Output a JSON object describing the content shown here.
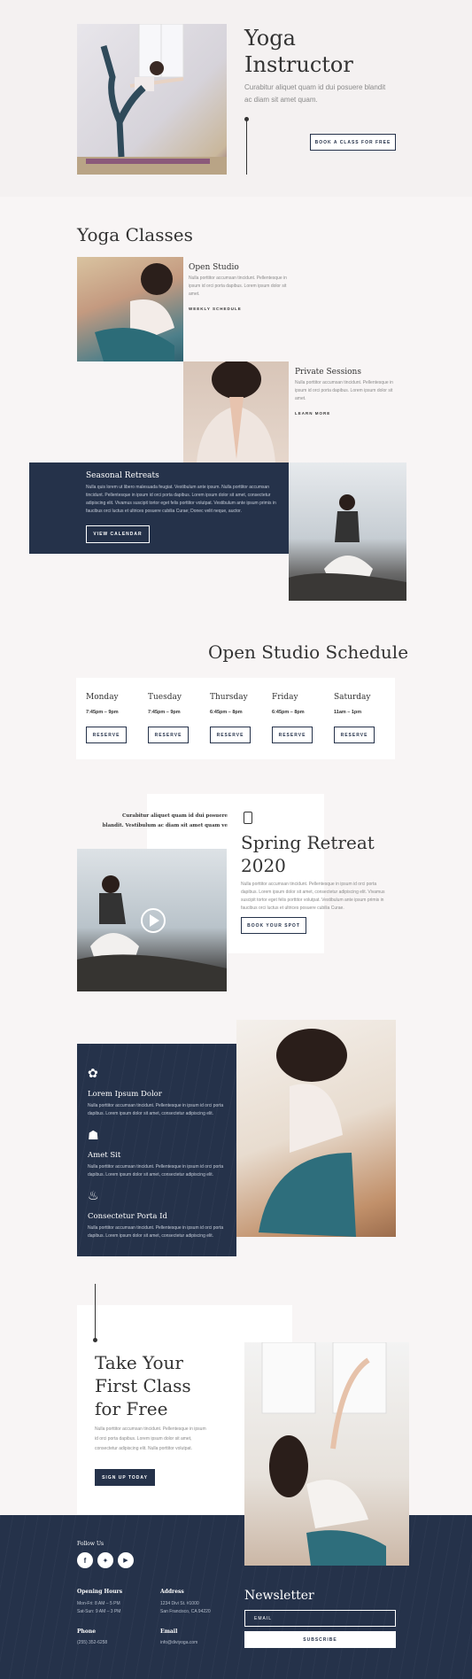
{
  "hero": {
    "title_line1": "Yoga",
    "title_line2": "Instructor",
    "subtitle": "Curabitur aliquet quam id dui posuere blandit ac diam sit amet quam.",
    "cta": "BOOK A CLASS FOR FREE"
  },
  "classes": {
    "heading": "Yoga Classes",
    "items": [
      {
        "title": "Open Studio",
        "text": "Nulla porttitor accumsan tincidunt. Pellentesque in ipsum id orci porta dapibus. Lorem ipsum dolor sit amet.",
        "link": "WEEKLY SCHEDULE"
      },
      {
        "title": "Private Sessions",
        "text": "Nulla porttitor accumsan tincidunt. Pellentesque in ipsum id orci porta dapibus. Lorem ipsum dolor sit amet.",
        "link": "LEARN MORE"
      },
      {
        "title": "Seasonal Retreats",
        "text": "Nulla quis lorem ut libero malesuada feugiat. Vestibulum ante ipsum. Nulla porttitor accumsan tincidunt. Pellentesque in ipsum id orci porta dapibus. Lorem ipsum dolor sit amet, consectetur adipiscing elit. Vivamus suscipit tortor eget felis porttitor volutpat. Vestibulum ante ipsum primis in faucibus orci luctus et ultrices posuere cubilia Curae; Donec velit neque, auctor.",
        "link": "VIEW CALENDAR"
      }
    ]
  },
  "schedule": {
    "heading": "Open Studio Schedule",
    "reserve_label": "RESERVE",
    "days": [
      {
        "day": "Monday",
        "time": "7:45pm – 9pm"
      },
      {
        "day": "Tuesday",
        "time": "7:45pm – 9pm"
      },
      {
        "day": "Thursday",
        "time": "6:45pm – 8pm"
      },
      {
        "day": "Friday",
        "time": "6:45pm – 8pm"
      },
      {
        "day": "Saturday",
        "time": "11am – 1pm"
      }
    ]
  },
  "retreat": {
    "quote": "Curabitur aliquet quam id dui posuere blandit. Vestibulum ac diam sit amet quam ve",
    "title_line1": "Spring Retreat",
    "title_line2": "2020",
    "text": "Nulla porttitor accumsan tincidunt. Pellentesque in ipsum id orci porta dapibus. Lorem ipsum dolor sit amet, consectetur adipiscing elit. Vivamus suscipit tortor eget felis porttitor volutpat. Vestibulum ante ipsum primis in faucibus orci luctus et ultrices posuere cubilia Curae.",
    "cta": "BOOK YOUR SPOT"
  },
  "features": [
    {
      "icon": "lotus-icon",
      "title": "Lorem Ipsum Dolor",
      "text": "Nulla porttitor accumsan tincidunt. Pellentesque in ipsum id orci porta dapibus. Lorem ipsum dolor sit amet, consectetur adipiscing elit."
    },
    {
      "icon": "stones-icon",
      "title": "Amet Sit",
      "text": "Nulla porttitor accumsan tincidunt. Pellentesque in ipsum id orci porta dapibus. Lorem ipsum dolor sit amet, consectetur adipiscing elit."
    },
    {
      "icon": "mortar-icon",
      "title": "Consectetur Porta Id",
      "text": "Nulla porttitor accumsan tincidunt. Pellentesque in ipsum id orci porta dapibus. Lorem ipsum dolor sit amet, consectetur adipiscing elit."
    }
  ],
  "free_class": {
    "title_line1": "Take Your",
    "title_line2": "First Class",
    "title_line3": "for Free",
    "text": "Nulla porttitor accumsan tincidunt. Pellentesque in ipsum id orci porta dapibus. Lorem ipsum dolor sit amet, consectetur adipiscing elit. Nulla porttitor volutpat.",
    "cta": "SIGN UP TODAY"
  },
  "footer": {
    "follow": "Follow Us",
    "hours_label": "Opening Hours",
    "hours_text1": "Mon-Fri: 8 AM – 5 PM",
    "hours_text2": "Sat-Sun: 9 AM – 3 PM",
    "address_label": "Address",
    "address_text1": "1234 Divi St. #1000",
    "address_text2": "San Francisco, CA 94220",
    "phone_label": "Phone",
    "phone_text": "(255) 352-6258",
    "email_label": "Email",
    "email_text": "info@diviyoga.com",
    "newsletter_title": "Newsletter",
    "email_placeholder": "EMAIL",
    "subscribe": "SUBSCRIBE"
  },
  "colors": {
    "navy": "#25324a",
    "background": "#f8f5f5",
    "text": "#333333"
  }
}
